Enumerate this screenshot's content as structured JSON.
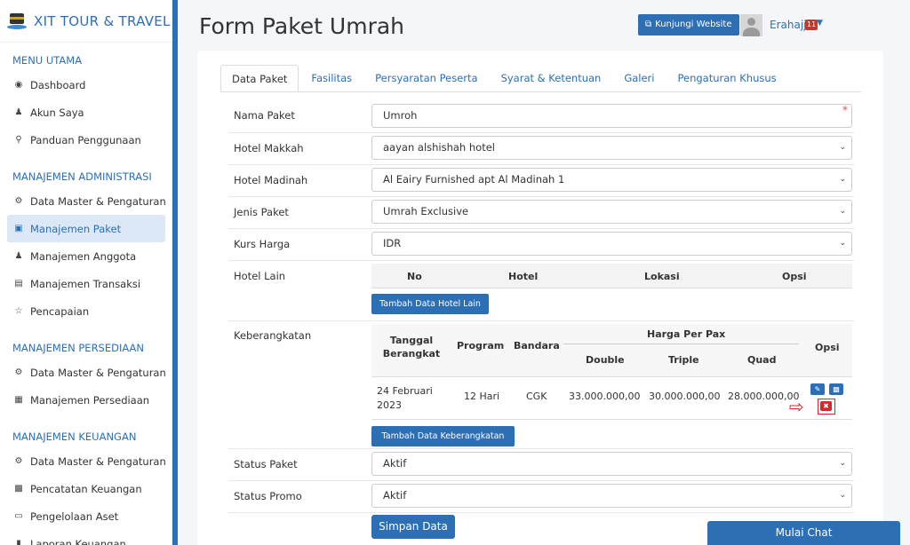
{
  "brand": {
    "title": "XIT TOUR & TRAVEL"
  },
  "sidebar": {
    "sections": [
      {
        "heading": "MENU UTAMA",
        "items": [
          {
            "label": "Dashboard",
            "icon": "globe-icon"
          },
          {
            "label": "Akun Saya",
            "icon": "user-icon"
          },
          {
            "label": "Panduan Penggunaan",
            "icon": "bulb-icon"
          }
        ]
      },
      {
        "heading": "MANAJEMEN ADMINISTRASI",
        "items": [
          {
            "label": "Data Master & Pengaturan",
            "icon": "gears-icon"
          },
          {
            "label": "Manajemen Paket",
            "icon": "book-icon",
            "active": true
          },
          {
            "label": "Manajemen Anggota",
            "icon": "users-icon"
          },
          {
            "label": "Manajemen Transaksi",
            "icon": "cart-icon"
          },
          {
            "label": "Pencapaian",
            "icon": "star-icon"
          }
        ]
      },
      {
        "heading": "MANAJEMEN PERSEDIAAN",
        "items": [
          {
            "label": "Data Master & Pengaturan",
            "icon": "gears-icon"
          },
          {
            "label": "Manajemen Persediaan",
            "icon": "cubes-icon"
          }
        ]
      },
      {
        "heading": "MANAJEMEN KEUANGAN",
        "items": [
          {
            "label": "Data Master & Pengaturan",
            "icon": "gears-icon"
          },
          {
            "label": "Pencatatan Keuangan",
            "icon": "money-icon"
          },
          {
            "label": "Pengelolaan Aset",
            "icon": "inbox-icon"
          },
          {
            "label": "Laporan Keuangan",
            "icon": "chart-icon"
          }
        ]
      }
    ]
  },
  "header": {
    "title": "Form Paket Umrah",
    "visit_button": "Kunjungi Website",
    "username": "Erahajj",
    "notif_count": "11"
  },
  "tabs": [
    "Data Paket",
    "Fasilitas",
    "Persyaratan Peserta",
    "Syarat & Ketentuan",
    "Galeri",
    "Pengaturan Khusus"
  ],
  "form": {
    "nama_paket": {
      "label": "Nama Paket",
      "value": "Umroh",
      "required_mark": "*"
    },
    "hotel_makkah": {
      "label": "Hotel Makkah",
      "value": "aayan alshishah hotel"
    },
    "hotel_madinah": {
      "label": "Hotel Madinah",
      "value": "Al Eairy Furnished apt Al Madinah 1"
    },
    "jenis_paket": {
      "label": "Jenis Paket",
      "value": "Umrah Exclusive"
    },
    "kurs_harga": {
      "label": "Kurs Harga",
      "value": "IDR"
    },
    "hotel_lain": {
      "label": "Hotel Lain",
      "columns": [
        "No",
        "Hotel",
        "Lokasi",
        "Opsi"
      ],
      "add_button": "Tambah Data Hotel Lain"
    },
    "keberangkatan": {
      "label": "Keberangkatan",
      "columns": {
        "tanggal": "Tanggal Berangkat",
        "program": "Program",
        "bandara": "Bandara",
        "harga_group": "Harga Per Pax",
        "double": "Double",
        "triple": "Triple",
        "quad": "Quad",
        "opsi": "Opsi"
      },
      "rows": [
        {
          "tanggal": "24 Februari 2023",
          "program": "12 Hari",
          "bandara": "CGK",
          "double": "33.000.000,00",
          "triple": "30.000.000,00",
          "quad": "28.000.000,00"
        }
      ],
      "add_button": "Tambah Data Keberangkatan"
    },
    "status_paket": {
      "label": "Status Paket",
      "value": "Aktif"
    },
    "status_promo": {
      "label": "Status Promo",
      "value": "Aktif"
    },
    "save_button": "Simpan Data"
  },
  "chat_button": "Mulai Chat",
  "colors": {
    "primary": "#2c6fb5",
    "danger": "#d62828"
  }
}
